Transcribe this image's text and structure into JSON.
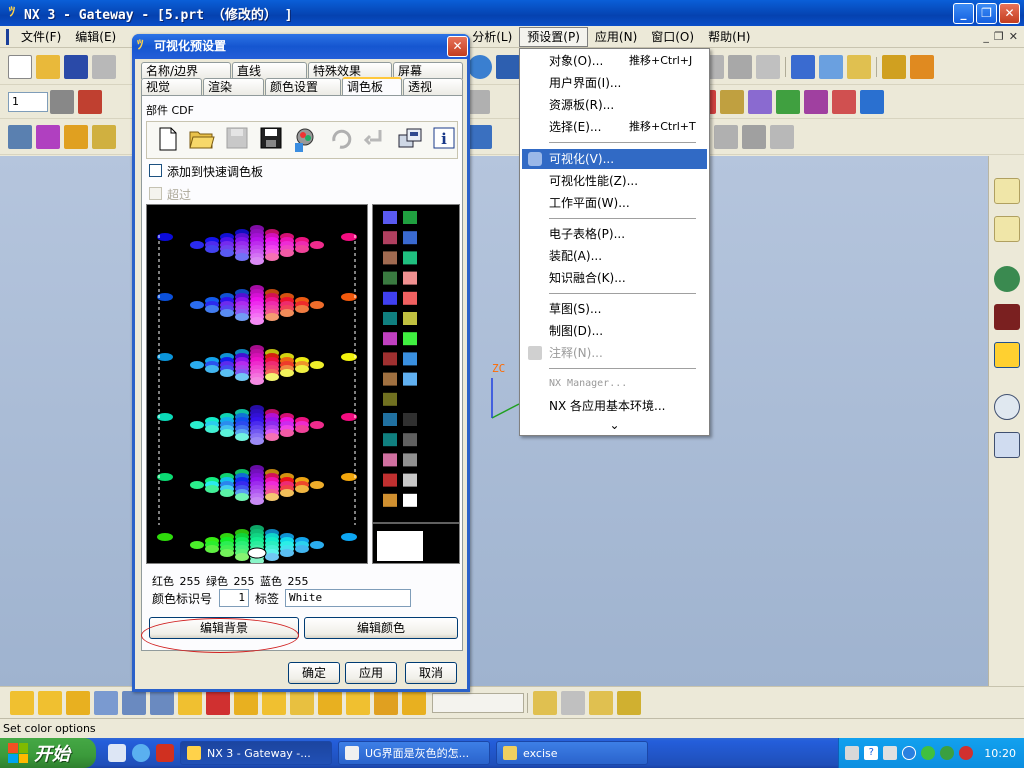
{
  "window": {
    "title": "NX 3 - Gateway - [5.prt （修改的） ]",
    "controls": [
      "_",
      "❐",
      "✕"
    ]
  },
  "menubar": {
    "items": [
      "文件(F)",
      "编辑(E)",
      "分析(L)",
      "预设置(P)",
      "应用(N)",
      "窗口(O)",
      "帮助(H)"
    ],
    "mdi_controls": [
      "_",
      "❐",
      "✕"
    ]
  },
  "toolbar": {
    "layer_select": "1"
  },
  "dropdown_menu": {
    "items": [
      {
        "label": "对象(O)...",
        "shortcut": "推移+Ctrl+J",
        "state": "normal"
      },
      {
        "label": "用户界面(I)...",
        "shortcut": "",
        "state": "normal"
      },
      {
        "label": "资源板(R)...",
        "shortcut": "",
        "state": "normal"
      },
      {
        "label": "选择(E)...",
        "shortcut": "推移+Ctrl+T",
        "state": "normal"
      },
      {
        "label": "可视化(V)...",
        "shortcut": "",
        "state": "highlighted"
      },
      {
        "label": "可视化性能(Z)...",
        "shortcut": "",
        "state": "normal"
      },
      {
        "label": "工作平面(W)...",
        "shortcut": "",
        "state": "normal"
      },
      {
        "label": "电子表格(P)...",
        "shortcut": "",
        "state": "normal"
      },
      {
        "label": "装配(A)...",
        "shortcut": "",
        "state": "normal"
      },
      {
        "label": "知识融合(K)...",
        "shortcut": "",
        "state": "normal"
      },
      {
        "label": "草图(S)...",
        "shortcut": "",
        "state": "normal"
      },
      {
        "label": "制图(D)...",
        "shortcut": "",
        "state": "normal"
      },
      {
        "label": "注释(N)...",
        "shortcut": "",
        "state": "disabled"
      },
      {
        "label": "NX Manager...",
        "shortcut": "",
        "state": "disabled"
      },
      {
        "label": "NX 各应用基本环境...",
        "shortcut": "",
        "state": "normal"
      }
    ],
    "more": "⌄"
  },
  "dialog": {
    "title": "可视化预设置",
    "tabs_row1": [
      "名称/边界",
      "直线",
      "特殊效果",
      "屏幕"
    ],
    "tabs_row2": [
      "视觉",
      "渲染",
      "颜色设置",
      "调色板",
      "透视"
    ],
    "active_tab": "调色板",
    "part_label": "部件 CDF",
    "add_quick_palette": "添加到快速调色板",
    "override": "超过",
    "rgb_line": "红色 255 绿色 255 蓝色 255",
    "color_id_label": "颜色标识号",
    "color_id_value": "1",
    "tag_label": "标签",
    "tag_value": "White",
    "edit_background": "编辑背景",
    "edit_color": "编辑颜色",
    "ok": "确定",
    "apply": "应用",
    "cancel": "取消"
  },
  "graphics": {
    "axis_label": "ZC"
  },
  "status_text": "Set color options",
  "taskbar": {
    "start": "开始",
    "buttons": [
      "NX 3 - Gateway -...",
      "UG界面是灰色的怎...",
      "excise"
    ],
    "clock": "10:20"
  }
}
